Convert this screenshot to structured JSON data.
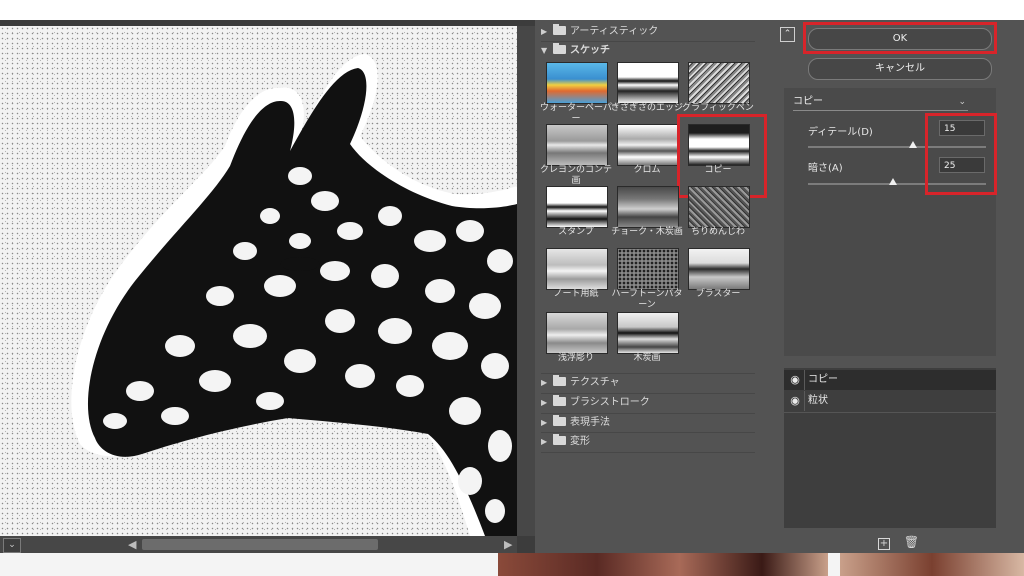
{
  "buttons": {
    "ok": "OK",
    "cancel": "キャンセル"
  },
  "categories": {
    "artistic": "アーティスティック",
    "sketch": "スケッチ",
    "texture": "テクスチャ",
    "brush_strokes": "ブラシストローク",
    "stylize": "表現手法",
    "distort": "変形"
  },
  "sketch_filters": [
    {
      "label": "ウォーターペーパー"
    },
    {
      "label": "ぎざぎざのエッジ"
    },
    {
      "label": "グラフィックペン"
    },
    {
      "label": "クレヨンのコンテ画"
    },
    {
      "label": "クロム"
    },
    {
      "label": "コピー",
      "selected": true
    },
    {
      "label": "スタンプ"
    },
    {
      "label": "チョーク・木炭画"
    },
    {
      "label": "ちりめんじわ"
    },
    {
      "label": "ノート用紙"
    },
    {
      "label": "ハーフトーンパターン"
    },
    {
      "label": "プラスター"
    },
    {
      "label": "浅浮彫り"
    },
    {
      "label": "木炭画"
    }
  ],
  "params": {
    "selected_filter": "コピー",
    "detail_label": "ディテール(D)",
    "detail_value": "15",
    "darkness_label": "暗さ(A)",
    "darkness_value": "25"
  },
  "slider_levels": {
    "detail": 0.59,
    "darkness": 0.48
  },
  "layers": [
    {
      "name": "コピー",
      "active": true
    },
    {
      "name": "粒状",
      "active": false
    }
  ],
  "icons": {
    "eye": "eye-icon",
    "new_layer": "add-effect-layer-icon",
    "delete": "trash-icon",
    "collapse": "collapse-gallery-icon"
  },
  "colors": {
    "highlight": "#d8242a",
    "panel": "#535353",
    "active_layer": "#2d2d2d"
  }
}
